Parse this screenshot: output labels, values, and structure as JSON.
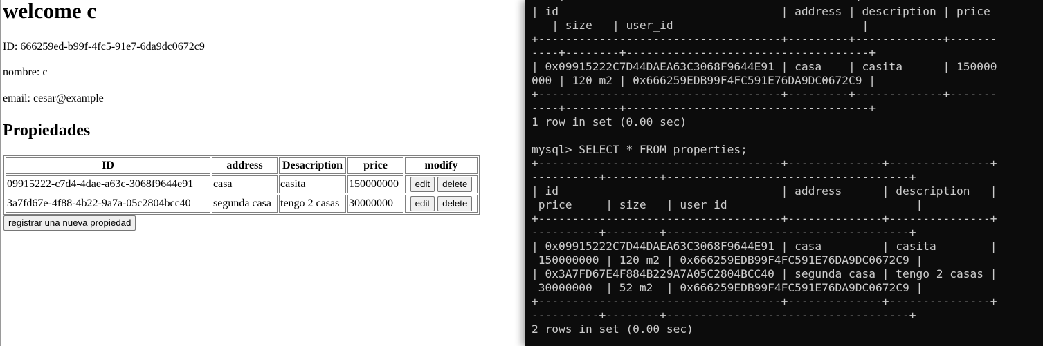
{
  "profile": {
    "welcome": "welcome c",
    "id_line": "ID: 666259ed-b99f-4fc5-91e7-6da9dc0672c9",
    "name_line": "nombre: c",
    "email_line": "email: cesar@example"
  },
  "properties": {
    "heading": "Propiedades",
    "columns": [
      "ID",
      "address",
      "Desacription",
      "price",
      "modify"
    ],
    "rows": [
      {
        "id": "09915222-c7d4-4dae-a63c-3068f9644e91",
        "address": "casa",
        "description": "casita",
        "price": "150000000"
      },
      {
        "id": "3a7fd67e-4f88-4b22-9a7a-05c2804bcc40",
        "address": "segunda casa",
        "description": "tengo 2 casas",
        "price": "30000000"
      }
    ],
    "edit_label": "edit",
    "delete_label": "delete",
    "register_label": "registrar una nueva propiedad"
  },
  "terminal": {
    "lines": [
      "----+-------------------------------------------+",
      "| id                                 | address | description | price",
      "   | size   | user_id                            |",
      "+------------------------------------+---------+-------------+-------",
      "----+--------+------------------------------------+",
      "| 0x09915222C7D44DAEA63C3068F9644E91 | casa    | casita      | 150000",
      "000 | 120 m2 | 0x666259EDB99F4FC591E76DA9DC0672C9 |",
      "+------------------------------------+---------+-------------+-------",
      "----+--------+------------------------------------+",
      "1 row in set (0.00 sec)",
      "",
      "mysql> SELECT * FROM properties;",
      "+------------------------------------+--------------+---------------+",
      "----------+--------+------------------------------------+",
      "| id                                 | address      | description   |",
      " price     | size   | user_id                            |",
      "+------------------------------------+--------------+---------------+",
      "----------+--------+------------------------------------+",
      "| 0x09915222C7D44DAEA63C3068F9644E91 | casa         | casita        |",
      " 150000000 | 120 m2 | 0x666259EDB99F4FC591E76DA9DC0672C9 |",
      "| 0x3A7FD67E4F884B229A7A05C2804BCC40 | segunda casa | tengo 2 casas |",
      " 30000000  | 52 m2  | 0x666259EDB99F4FC591E76DA9DC0672C9 |",
      "+------------------------------------+--------------+---------------+",
      "----------+--------+------------------------------------+",
      "2 rows in set (0.00 sec)"
    ]
  }
}
